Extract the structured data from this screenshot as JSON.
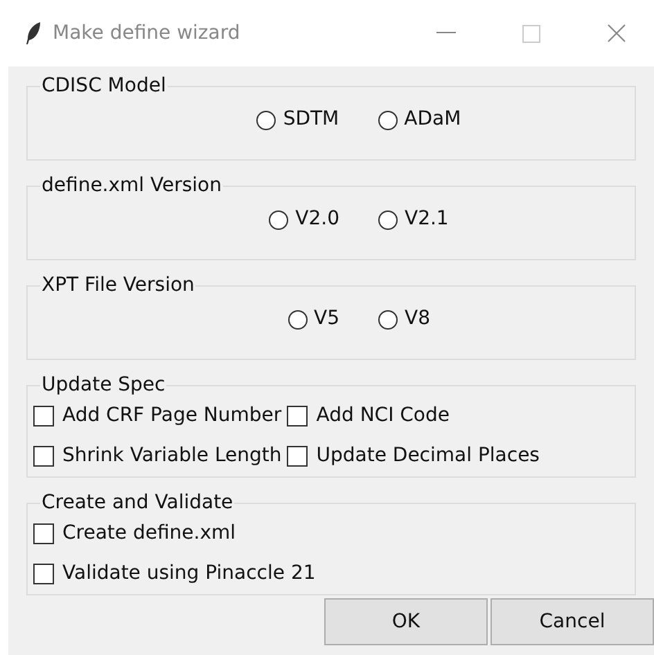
{
  "window": {
    "title": "Make define wizard"
  },
  "radio_groups": [
    {
      "title": "CDISC Model",
      "options": [
        {
          "label": "SDTM",
          "selected": false
        },
        {
          "label": "ADaM",
          "selected": false
        }
      ]
    },
    {
      "title": "define.xml Version",
      "options": [
        {
          "label": "V2.0",
          "selected": false
        },
        {
          "label": "V2.1",
          "selected": false
        }
      ]
    },
    {
      "title": "XPT File Version",
      "options": [
        {
          "label": "V5",
          "selected": false
        },
        {
          "label": "V8",
          "selected": false
        }
      ]
    }
  ],
  "update_spec": {
    "title": "Update Spec",
    "options": [
      {
        "label": "Add CRF Page Number",
        "checked": false
      },
      {
        "label": "Add NCI Code",
        "checked": false
      },
      {
        "label": "Shrink Variable Length",
        "checked": false
      },
      {
        "label": "Update Decimal Places",
        "checked": false
      }
    ]
  },
  "create_validate": {
    "title": "Create and Validate",
    "options": [
      {
        "label": "Create define.xml",
        "checked": false
      },
      {
        "label": "Validate using Pinaccle 21",
        "checked": false
      }
    ]
  },
  "buttons": [
    "OK",
    "Cancel"
  ]
}
